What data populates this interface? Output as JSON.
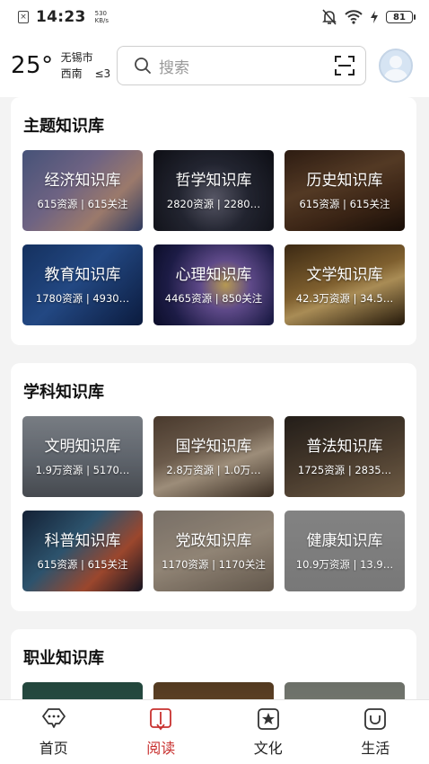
{
  "status_bar": {
    "time": "14:23",
    "netspeed_value": "530",
    "netspeed_unit": "KB/s",
    "battery": "81"
  },
  "header": {
    "temperature": "25°",
    "city": "无锡市",
    "wind_direction": "西南",
    "wind_level": "≤3",
    "search_placeholder": "搜索"
  },
  "sections": [
    {
      "title": "主题知识库",
      "tiles": [
        {
          "name": "经济知识库",
          "stats": "615资源 | 615关注"
        },
        {
          "name": "哲学知识库",
          "stats": "2820资源 | 2280…"
        },
        {
          "name": "历史知识库",
          "stats": "615资源 | 615关注"
        },
        {
          "name": "教育知识库",
          "stats": "1780资源 | 4930…"
        },
        {
          "name": "心理知识库",
          "stats": "4465资源 | 850关注"
        },
        {
          "name": "文学知识库",
          "stats": "42.3万资源 | 34.5…"
        }
      ]
    },
    {
      "title": "学科知识库",
      "tiles": [
        {
          "name": "文明知识库",
          "stats": "1.9万资源 | 5170…"
        },
        {
          "name": "国学知识库",
          "stats": "2.8万资源 | 1.0万…"
        },
        {
          "name": "普法知识库",
          "stats": "1725资源 | 2835…"
        },
        {
          "name": "科普知识库",
          "stats": "615资源 | 615关注"
        },
        {
          "name": "党政知识库",
          "stats": "1170资源 | 1170关注"
        },
        {
          "name": "健康知识库",
          "stats": "10.9万资源 | 13.9…"
        }
      ]
    },
    {
      "title": "职业知识库"
    }
  ],
  "bottom_nav": [
    {
      "label": "首页",
      "icon": "home-chat-icon",
      "active": false
    },
    {
      "label": "阅读",
      "icon": "book-icon",
      "active": true
    },
    {
      "label": "文化",
      "icon": "star-frame-icon",
      "active": false
    },
    {
      "label": "生活",
      "icon": "smile-bag-icon",
      "active": false
    }
  ],
  "colors": {
    "accent": "#c8312f",
    "background": "#f3f3f3"
  }
}
